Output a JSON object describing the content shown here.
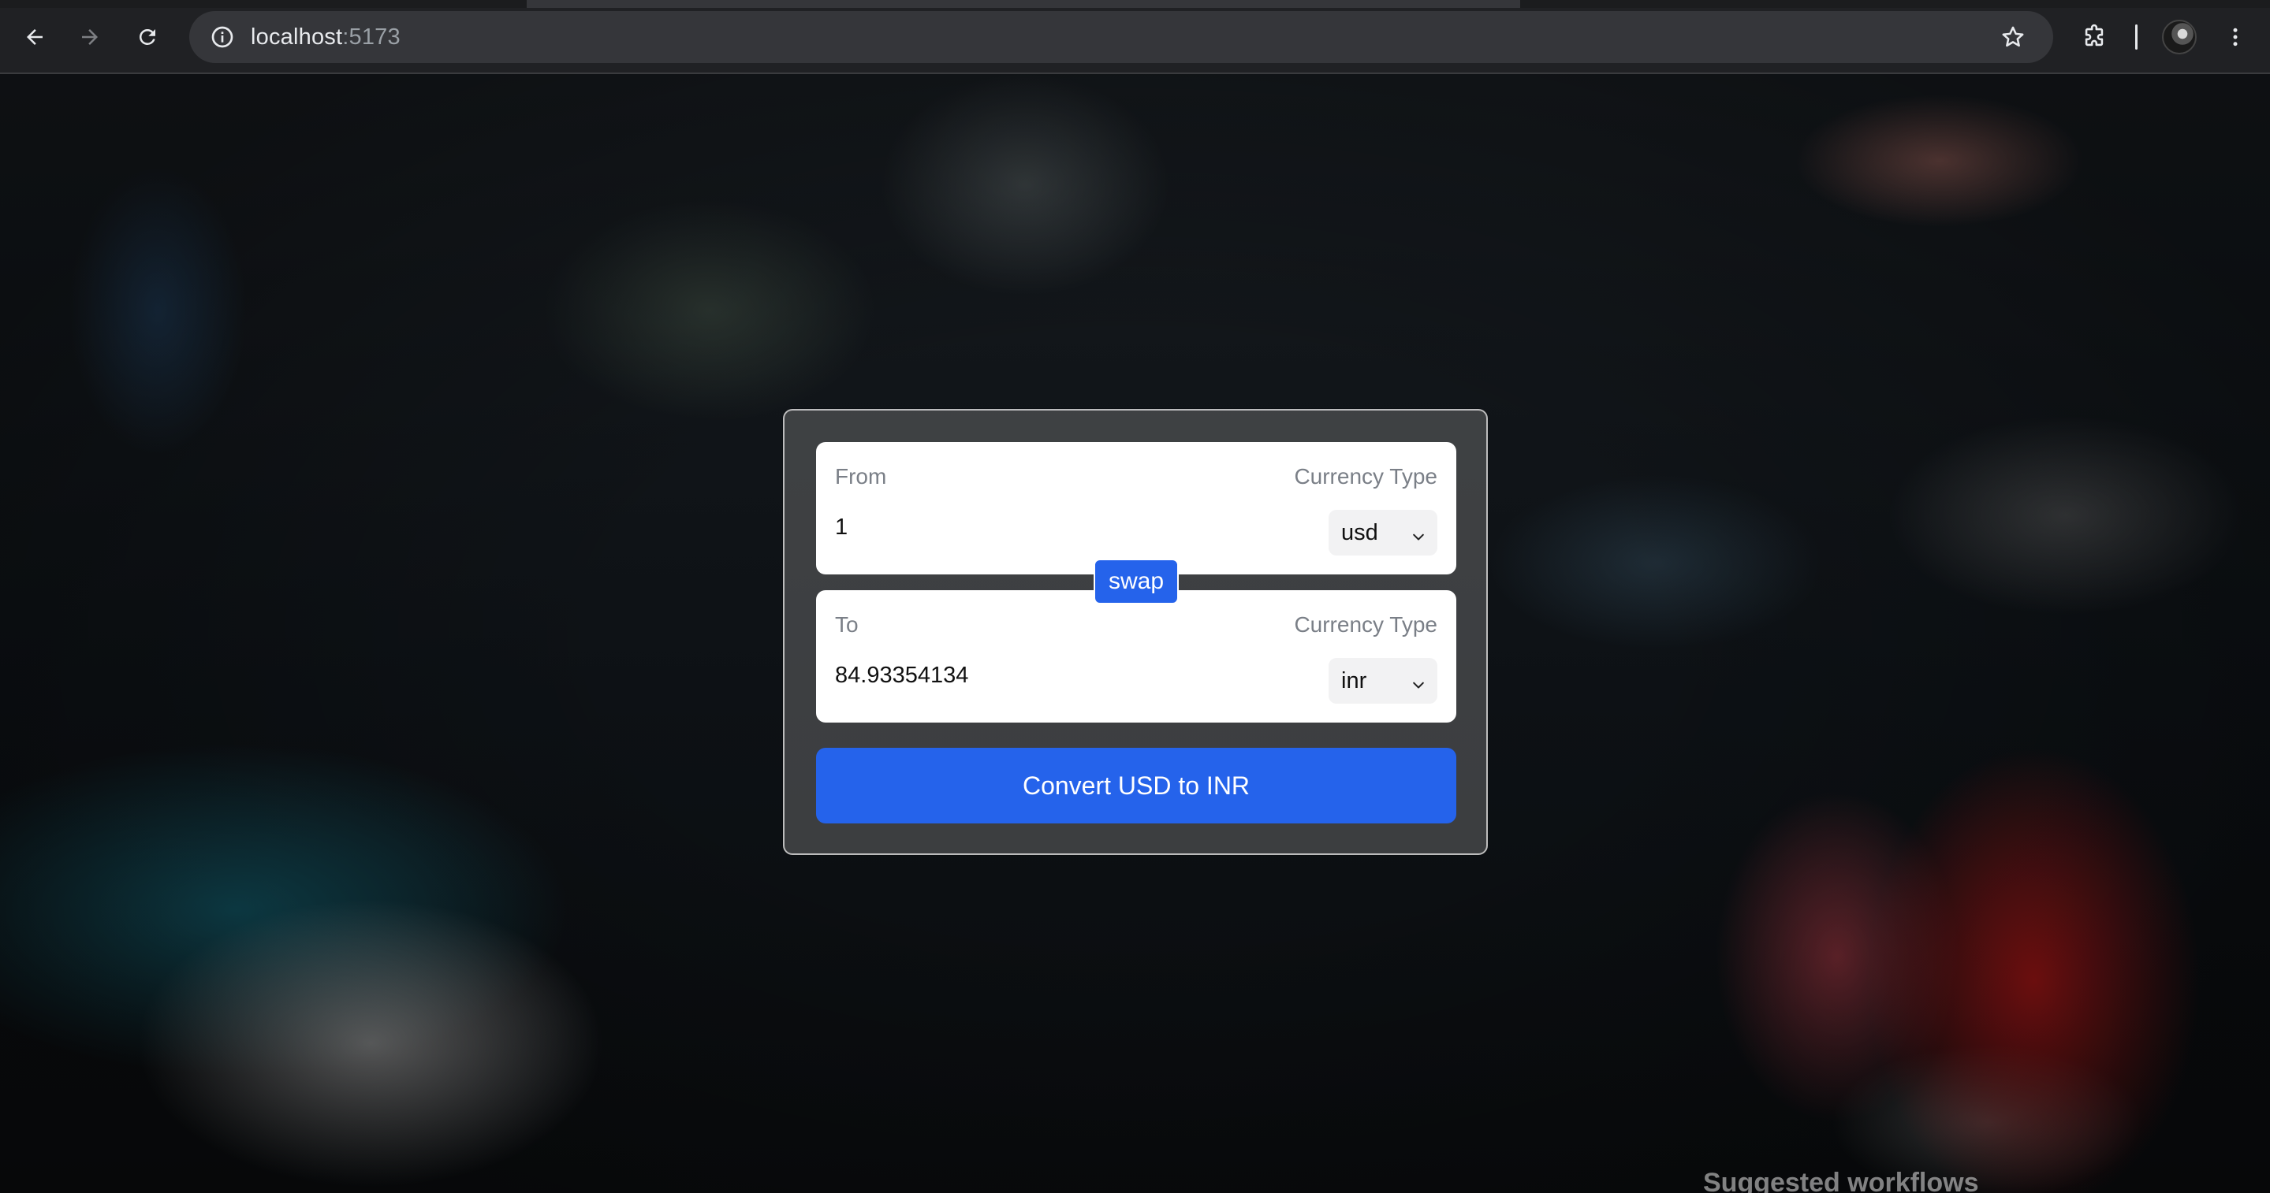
{
  "browser": {
    "url_host": "localhost",
    "url_port": ":5173",
    "icons": [
      "back-arrow-icon",
      "forward-arrow-icon",
      "reload-icon",
      "site-info-icon",
      "bookmark-star-icon",
      "extensions-puzzle-icon",
      "profile-avatar",
      "kebab-menu-icon"
    ]
  },
  "converter": {
    "from": {
      "label": "From",
      "currency_label": "Currency Type",
      "amount": "1",
      "currency": "usd"
    },
    "to": {
      "label": "To",
      "currency_label": "Currency Type",
      "amount": "84.93354134",
      "currency": "inr"
    },
    "swap_label": "swap",
    "convert_label": "Convert USD to INR",
    "accent_color": "#2563eb"
  },
  "page": {
    "footer_partial_text": "Suggested workflows"
  }
}
